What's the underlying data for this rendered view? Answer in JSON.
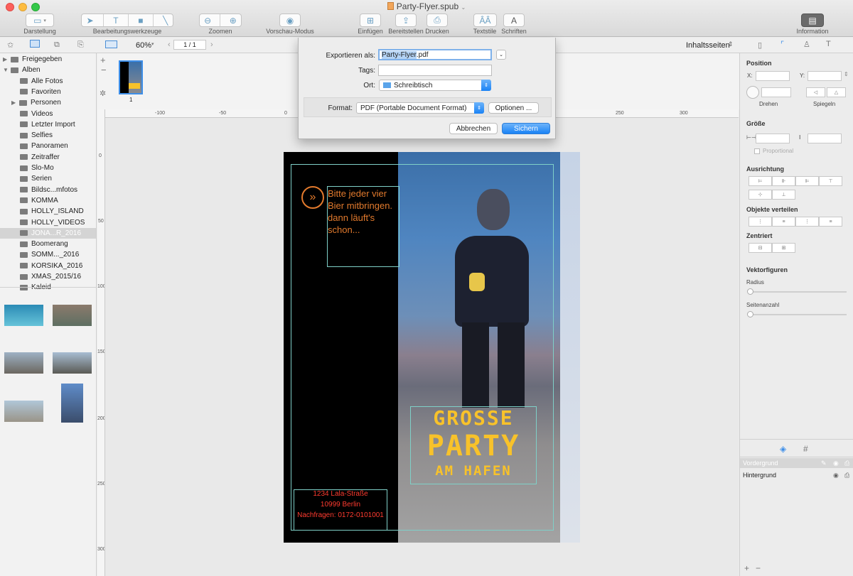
{
  "window": {
    "title": "Party-Flyer.spub"
  },
  "toolbar": {
    "darstellung": "Darstellung",
    "bearbeitungswerkzeuge": "Bearbeitungswerkzeuge",
    "zoomen": "Zoomen",
    "vorschau": "Vorschau-Modus",
    "einfuegen": "Einfügen",
    "bereitstellen": "Bereitstellen",
    "drucken": "Drucken",
    "textstile": "Textstile",
    "schriften": "Schriften",
    "information": "Information"
  },
  "subbar": {
    "zoom": "60%",
    "page": "1 / 1",
    "content_pages": "Inhaltsseiten"
  },
  "sidebar": {
    "items": [
      {
        "label": "Freigegeben",
        "level": 0,
        "disclosure": "▶"
      },
      {
        "label": "Alben",
        "level": 0,
        "disclosure": "▼"
      },
      {
        "label": "Alle Fotos",
        "level": 1
      },
      {
        "label": "Favoriten",
        "level": 1
      },
      {
        "label": "Personen",
        "level": 1,
        "disclosure": "▶"
      },
      {
        "label": "Videos",
        "level": 1
      },
      {
        "label": "Letzter Import",
        "level": 1
      },
      {
        "label": "Selfies",
        "level": 1
      },
      {
        "label": "Panoramen",
        "level": 1
      },
      {
        "label": "Zeitraffer",
        "level": 1
      },
      {
        "label": "Slo-Mo",
        "level": 1
      },
      {
        "label": "Serien",
        "level": 1
      },
      {
        "label": "Bildsc...mfotos",
        "level": 1
      },
      {
        "label": "KOMMA",
        "level": 1
      },
      {
        "label": "HOLLY_ISLAND",
        "level": 1
      },
      {
        "label": "HOLLY_VIDEOS",
        "level": 1
      },
      {
        "label": "JONA...R_2016",
        "level": 1,
        "selected": true
      },
      {
        "label": "Boomerang",
        "level": 1
      },
      {
        "label": "SOMM..._2016",
        "level": 1
      },
      {
        "label": "KORSIKA_2016",
        "level": 1
      },
      {
        "label": "XMAS_2015/16",
        "level": 1
      },
      {
        "label": "Kaleid",
        "level": 1
      }
    ]
  },
  "page_thumb": {
    "number": "1"
  },
  "ruler": {
    "h_ticks": [
      "-100",
      "-50",
      "0",
      "250",
      "300"
    ],
    "v_ticks": [
      "0",
      "50",
      "100",
      "150",
      "200",
      "250",
      "300"
    ]
  },
  "export_dialog": {
    "export_as_label": "Exportieren als:",
    "filename_selected": "Party-Flyer",
    "filename_rest": ".pdf",
    "tags_label": "Tags:",
    "location_label": "Ort:",
    "location_value": "Schreibtisch",
    "format_label": "Format:",
    "format_value": "PDF (Portable Document Format)",
    "options_button": "Optionen ...",
    "cancel_button": "Abbrechen",
    "save_button": "Sichern"
  },
  "flyer": {
    "note_lines": [
      "Bitte jeder vier",
      "Bier mitbringen.",
      "dann läuft's",
      "schon..."
    ],
    "party_line1": "GROSSE",
    "party_line2": "PARTY",
    "party_line3": "AM HAFEN",
    "address_lines": [
      "1234  Lala-Straße",
      "10999  Berlin",
      "Nachfragen:  0172-0101001"
    ],
    "accent_orange": "#e27a2d",
    "accent_yellow": "#f8c22a",
    "accent_red": "#ff3b2f"
  },
  "inspector": {
    "position": "Position",
    "x_label": "X:",
    "y_label": "Y:",
    "drehen": "Drehen",
    "spiegeln": "Spiegeln",
    "groesse": "Größe",
    "proportional": "Proportional",
    "ausrichtung": "Ausrichtung",
    "verteilen": "Objekte verteilen",
    "zentriert": "Zentriert",
    "vektor": "Vektorfiguren",
    "radius": "Radius",
    "seitenanzahl": "Seitenanzahl"
  },
  "layers": {
    "vordergrund": "Vordergrund",
    "hintergrund": "Hintergrund"
  },
  "icons": {
    "doc": "document-icon",
    "info": "info-icon",
    "layers": "layers-icon",
    "grid": "grid-icon"
  }
}
